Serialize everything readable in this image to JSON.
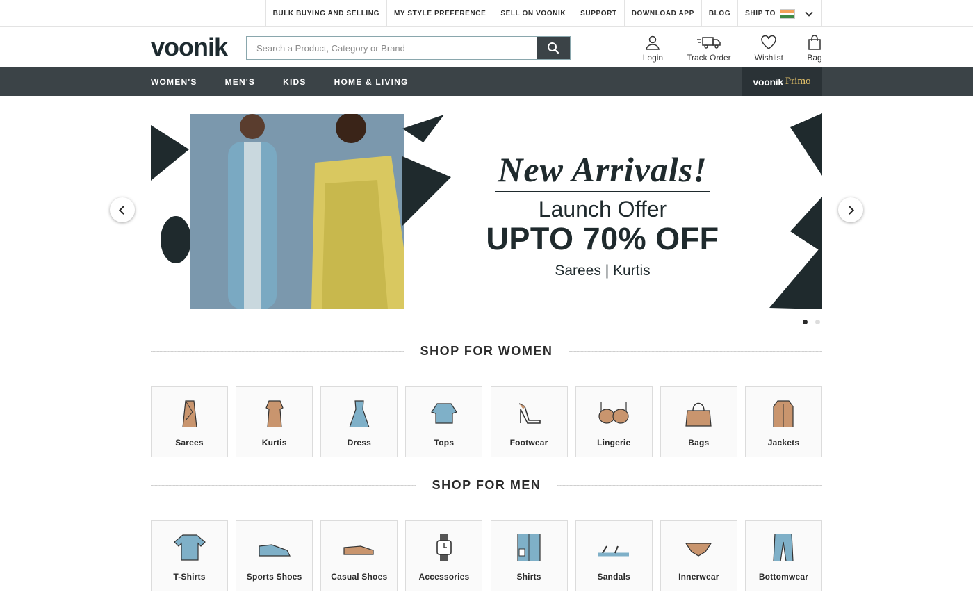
{
  "topbar": {
    "links": [
      "BULK BUYING AND SELLING",
      "MY STYLE PREFERENCE",
      "SELL ON VOONIK",
      "SUPPORT",
      "DOWNLOAD APP",
      "BLOG"
    ],
    "ship_to": "SHIP TO"
  },
  "header": {
    "logo": "voonik",
    "search_placeholder": "Search a Product, Category or Brand",
    "icons": [
      {
        "label": "Login",
        "icon": "user-icon"
      },
      {
        "label": "Track Order",
        "icon": "truck-icon"
      },
      {
        "label": "Wishlist",
        "icon": "heart-icon"
      },
      {
        "label": "Bag",
        "icon": "bag-icon"
      }
    ]
  },
  "nav": {
    "items": [
      "WOMEN'S",
      "MEN'S",
      "KIDS",
      "HOME & LIVING"
    ],
    "primo_brand": "voonik",
    "primo_suffix": "Primo"
  },
  "hero": {
    "headline": "New Arrivals!",
    "sub": "Launch Offer",
    "offer": "UPTO 70% OFF",
    "categories": "Sarees | Kurtis",
    "active_slide": 1,
    "slide_count": 2
  },
  "women": {
    "title": "SHOP FOR WOMEN",
    "items": [
      "Sarees",
      "Kurtis",
      "Dress",
      "Tops",
      "Footwear",
      "Lingerie",
      "Bags",
      "Jackets"
    ]
  },
  "men": {
    "title": "SHOP FOR MEN",
    "items": [
      "T-Shirts",
      "Sports Shoes",
      "Casual Shoes",
      "Accessories",
      "Shirts",
      "Sandals",
      "Innerwear",
      "Bottomwear"
    ]
  },
  "colors": {
    "nav_bg": "#3b4347",
    "primo_gold": "#e8c56a",
    "icon_blue": "#7fb0c8",
    "icon_brown": "#c9956e"
  }
}
